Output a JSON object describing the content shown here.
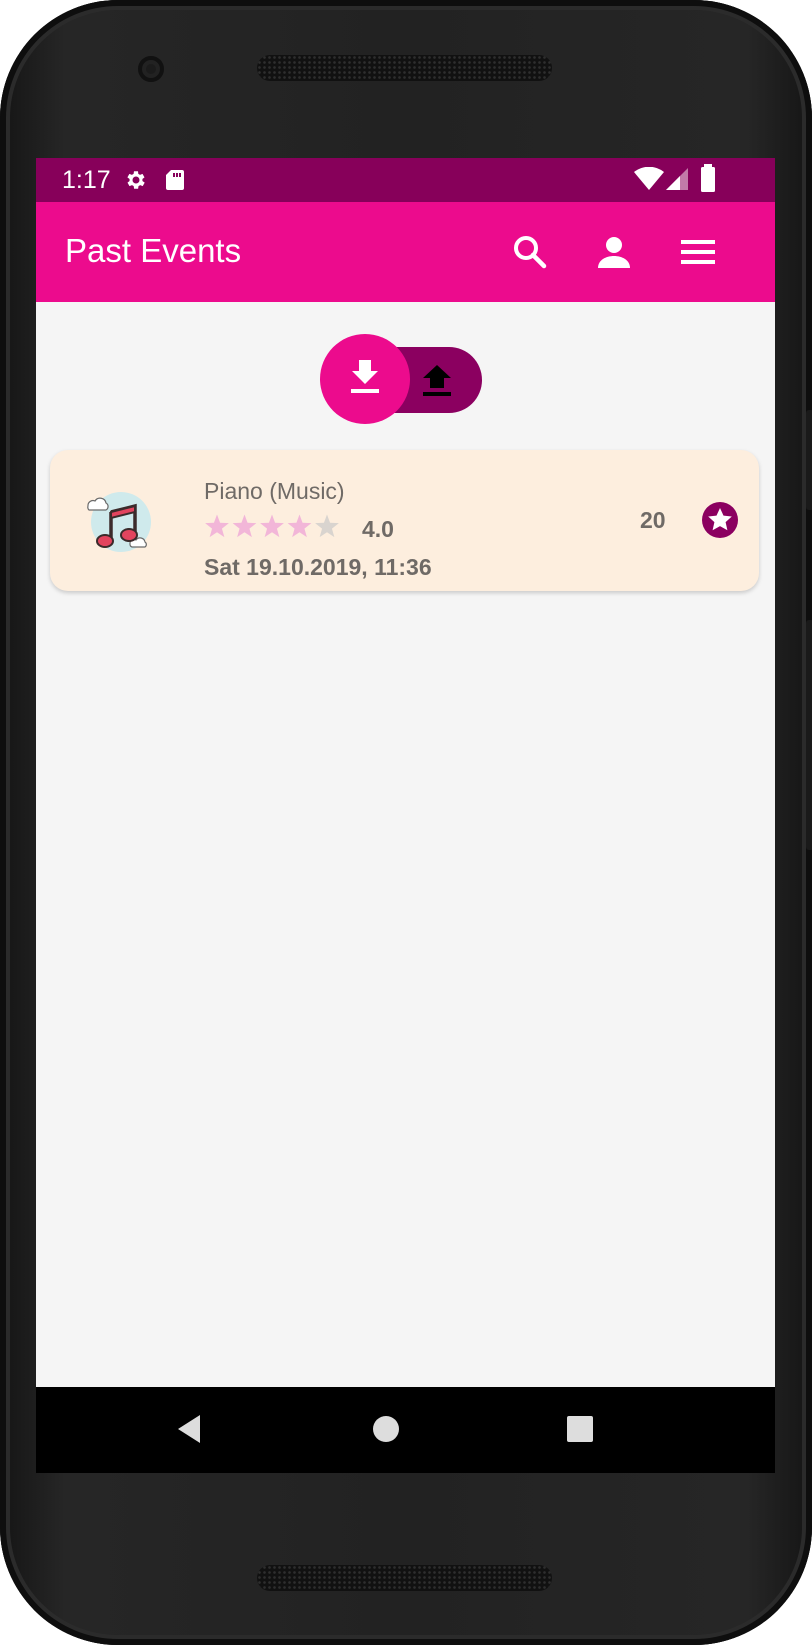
{
  "status_bar": {
    "time": "1:17"
  },
  "app_bar": {
    "title": "Past Events"
  },
  "toggle": {
    "active": "download"
  },
  "events": [
    {
      "name": "Piano (Music)",
      "rating_value": 4.0,
      "rating_text": "4.0",
      "stars_filled": 4,
      "stars_total": 5,
      "date": "Sat 19.10.2019, 11:36",
      "count": "20"
    }
  ],
  "colors": {
    "status_bar": "#87005a",
    "primary": "#ec0b8d",
    "primary_dark": "#8b0060",
    "card_bg": "#fdeede",
    "star_filled": "#f2b6d8",
    "star_empty": "#d9d4cf",
    "nav_bar": "#000000"
  },
  "icons": {
    "status": [
      "settings-icon",
      "sd-card-icon",
      "wifi-icon",
      "signal-icon",
      "battery-icon"
    ],
    "app_bar": [
      "search-icon",
      "account-icon",
      "menu-icon"
    ],
    "toggle": [
      "download-icon",
      "upload-icon"
    ],
    "event": [
      "music-note-icon",
      "star-badge-icon"
    ],
    "nav": [
      "back-icon",
      "home-icon",
      "recents-icon"
    ]
  }
}
